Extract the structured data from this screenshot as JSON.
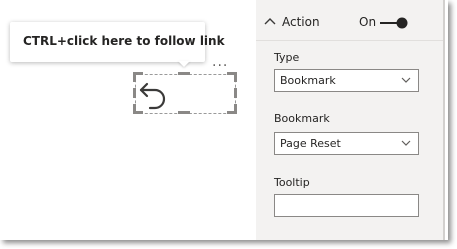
{
  "tooltip": {
    "text": "CTRL+click here to follow link"
  },
  "visual": {
    "more_options": "..."
  },
  "pane": {
    "action": {
      "label": "Action",
      "toggle_label": "On",
      "toggle_on": true
    },
    "type": {
      "label": "Type",
      "value": "Bookmark"
    },
    "bookmark": {
      "label": "Bookmark",
      "value": "Page Reset"
    },
    "tooltip_field": {
      "label": "Tooltip",
      "value": ""
    }
  },
  "icons": {
    "back": "back-arrow-icon",
    "section": "chevron-up-icon",
    "dropdown": "chevron-down-icon"
  },
  "colors": {
    "toggle_track": "#252423",
    "pane_background": "#f3f2f1"
  }
}
